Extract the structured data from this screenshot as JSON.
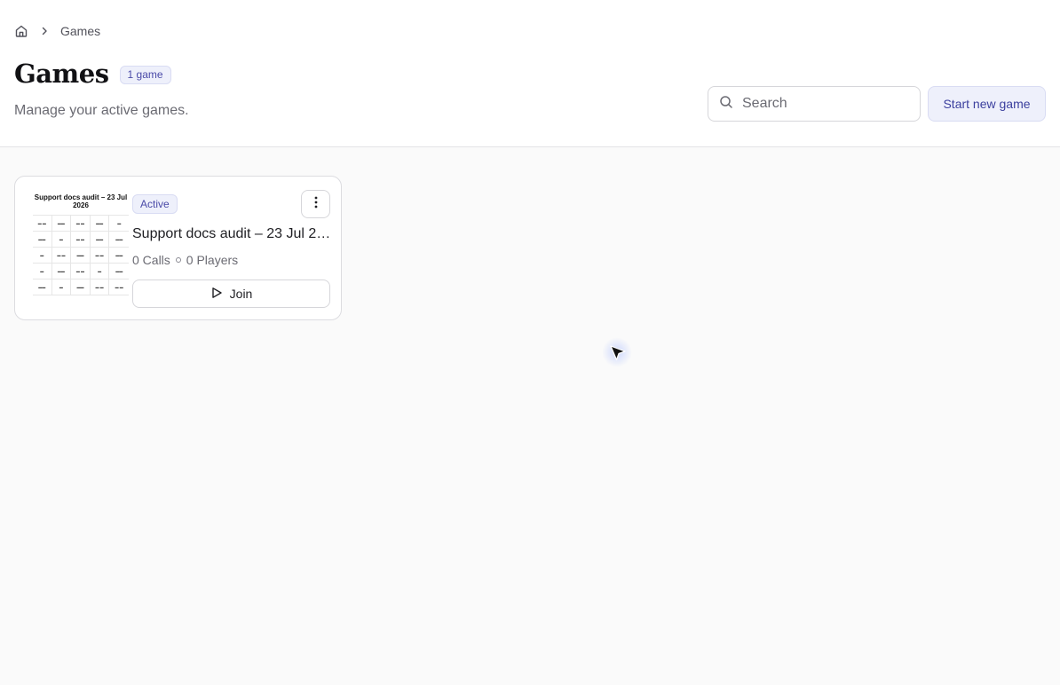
{
  "breadcrumb": {
    "home_icon": "home-icon",
    "separator_icon": "chevron-right-icon",
    "current": "Games"
  },
  "header": {
    "title": "Games",
    "count_badge": "1 game",
    "subtitle": "Manage your active games."
  },
  "search": {
    "placeholder": "Search",
    "value": "",
    "icon": "search-icon"
  },
  "actions": {
    "start_new_game": "Start new game"
  },
  "games": [
    {
      "status": "Active",
      "title": "Support docs audit – 23 Jul 2026",
      "calls": "0 Calls",
      "players": "0 Players",
      "join_label": "Join",
      "thumbnail_title": "Support docs audit – 23 Jul 2026"
    }
  ],
  "colors": {
    "accent": "#3b3f9e",
    "accent_bg": "#eef0fb",
    "page_bg": "#fafafa"
  }
}
